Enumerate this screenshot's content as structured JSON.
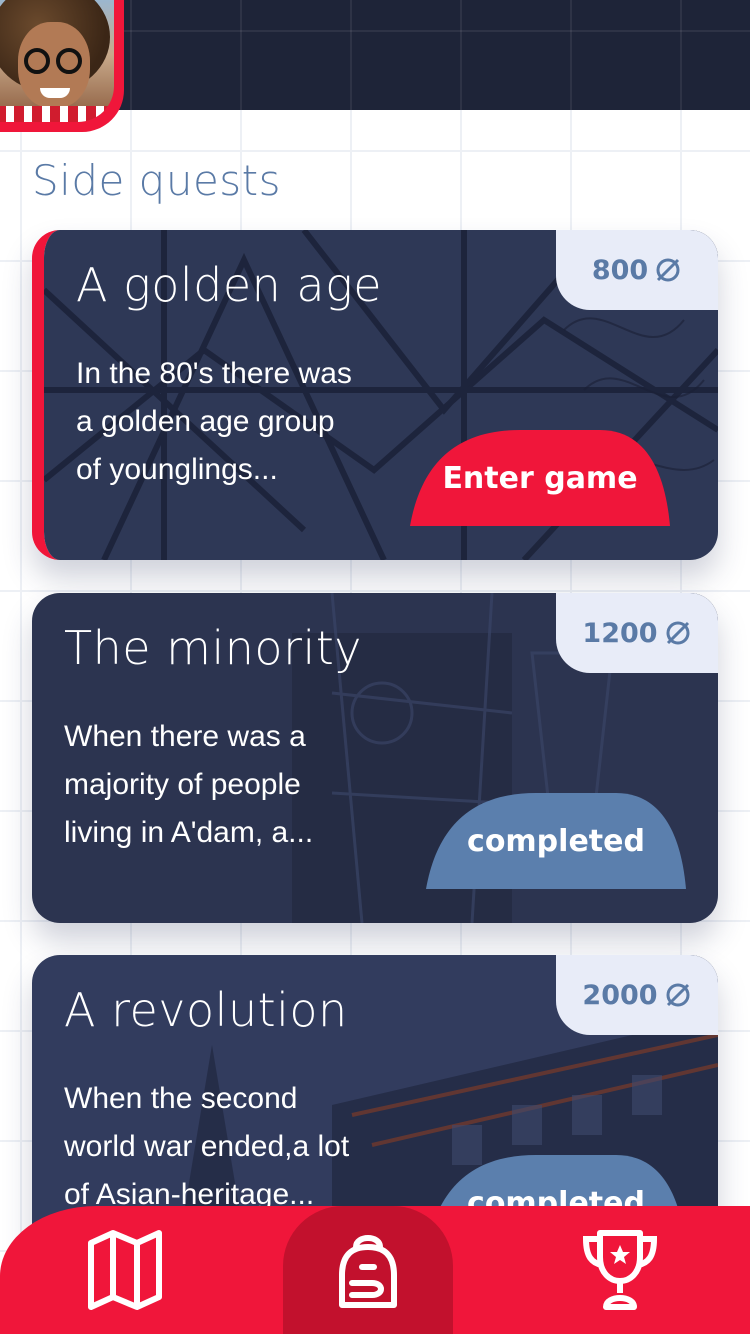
{
  "header": {
    "avatar_alt": "user-avatar"
  },
  "section_title": "Side quests",
  "quests": [
    {
      "title": "A golden age",
      "desc_lines": [
        "In the 80's there was",
        "a golden age group",
        "of younglings..."
      ],
      "points": "800",
      "action_label": "Enter game",
      "state": "active"
    },
    {
      "title": "The minority",
      "desc_lines": [
        "When there was a",
        "majority of people",
        "living in A'dam, a..."
      ],
      "points": "1200",
      "action_label": "completed",
      "state": "completed"
    },
    {
      "title": "A revolution",
      "desc_lines": [
        "When the second",
        "world war ended,a lot",
        "of Asian-heritage..."
      ],
      "points": "2000",
      "action_label": "completed",
      "state": "completed"
    }
  ],
  "bottom_nav": {
    "items": [
      {
        "icon": "map-icon",
        "selected": false
      },
      {
        "icon": "backpack-icon",
        "selected": true
      },
      {
        "icon": "trophy-icon",
        "selected": false
      }
    ]
  },
  "colors": {
    "accent": "#f0163a",
    "accent_dark": "#c2112d",
    "completed": "#5b7fad",
    "card_bg": "#2c3652",
    "title_blue": "#5a7aa6",
    "points_bg": "#e8ecf8"
  }
}
